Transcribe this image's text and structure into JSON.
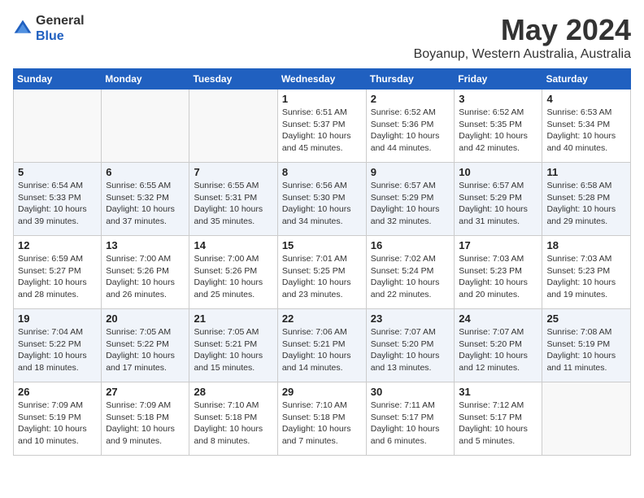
{
  "logo": {
    "general": "General",
    "blue": "Blue"
  },
  "title": {
    "month": "May 2024",
    "location": "Boyanup, Western Australia, Australia"
  },
  "days_of_week": [
    "Sunday",
    "Monday",
    "Tuesday",
    "Wednesday",
    "Thursday",
    "Friday",
    "Saturday"
  ],
  "weeks": [
    [
      {
        "day": null,
        "info": null
      },
      {
        "day": null,
        "info": null
      },
      {
        "day": null,
        "info": null
      },
      {
        "day": "1",
        "info": "Sunrise: 6:51 AM\nSunset: 5:37 PM\nDaylight: 10 hours\nand 45 minutes."
      },
      {
        "day": "2",
        "info": "Sunrise: 6:52 AM\nSunset: 5:36 PM\nDaylight: 10 hours\nand 44 minutes."
      },
      {
        "day": "3",
        "info": "Sunrise: 6:52 AM\nSunset: 5:35 PM\nDaylight: 10 hours\nand 42 minutes."
      },
      {
        "day": "4",
        "info": "Sunrise: 6:53 AM\nSunset: 5:34 PM\nDaylight: 10 hours\nand 40 minutes."
      }
    ],
    [
      {
        "day": "5",
        "info": "Sunrise: 6:54 AM\nSunset: 5:33 PM\nDaylight: 10 hours\nand 39 minutes."
      },
      {
        "day": "6",
        "info": "Sunrise: 6:55 AM\nSunset: 5:32 PM\nDaylight: 10 hours\nand 37 minutes."
      },
      {
        "day": "7",
        "info": "Sunrise: 6:55 AM\nSunset: 5:31 PM\nDaylight: 10 hours\nand 35 minutes."
      },
      {
        "day": "8",
        "info": "Sunrise: 6:56 AM\nSunset: 5:30 PM\nDaylight: 10 hours\nand 34 minutes."
      },
      {
        "day": "9",
        "info": "Sunrise: 6:57 AM\nSunset: 5:29 PM\nDaylight: 10 hours\nand 32 minutes."
      },
      {
        "day": "10",
        "info": "Sunrise: 6:57 AM\nSunset: 5:29 PM\nDaylight: 10 hours\nand 31 minutes."
      },
      {
        "day": "11",
        "info": "Sunrise: 6:58 AM\nSunset: 5:28 PM\nDaylight: 10 hours\nand 29 minutes."
      }
    ],
    [
      {
        "day": "12",
        "info": "Sunrise: 6:59 AM\nSunset: 5:27 PM\nDaylight: 10 hours\nand 28 minutes."
      },
      {
        "day": "13",
        "info": "Sunrise: 7:00 AM\nSunset: 5:26 PM\nDaylight: 10 hours\nand 26 minutes."
      },
      {
        "day": "14",
        "info": "Sunrise: 7:00 AM\nSunset: 5:26 PM\nDaylight: 10 hours\nand 25 minutes."
      },
      {
        "day": "15",
        "info": "Sunrise: 7:01 AM\nSunset: 5:25 PM\nDaylight: 10 hours\nand 23 minutes."
      },
      {
        "day": "16",
        "info": "Sunrise: 7:02 AM\nSunset: 5:24 PM\nDaylight: 10 hours\nand 22 minutes."
      },
      {
        "day": "17",
        "info": "Sunrise: 7:03 AM\nSunset: 5:23 PM\nDaylight: 10 hours\nand 20 minutes."
      },
      {
        "day": "18",
        "info": "Sunrise: 7:03 AM\nSunset: 5:23 PM\nDaylight: 10 hours\nand 19 minutes."
      }
    ],
    [
      {
        "day": "19",
        "info": "Sunrise: 7:04 AM\nSunset: 5:22 PM\nDaylight: 10 hours\nand 18 minutes."
      },
      {
        "day": "20",
        "info": "Sunrise: 7:05 AM\nSunset: 5:22 PM\nDaylight: 10 hours\nand 17 minutes."
      },
      {
        "day": "21",
        "info": "Sunrise: 7:05 AM\nSunset: 5:21 PM\nDaylight: 10 hours\nand 15 minutes."
      },
      {
        "day": "22",
        "info": "Sunrise: 7:06 AM\nSunset: 5:21 PM\nDaylight: 10 hours\nand 14 minutes."
      },
      {
        "day": "23",
        "info": "Sunrise: 7:07 AM\nSunset: 5:20 PM\nDaylight: 10 hours\nand 13 minutes."
      },
      {
        "day": "24",
        "info": "Sunrise: 7:07 AM\nSunset: 5:20 PM\nDaylight: 10 hours\nand 12 minutes."
      },
      {
        "day": "25",
        "info": "Sunrise: 7:08 AM\nSunset: 5:19 PM\nDaylight: 10 hours\nand 11 minutes."
      }
    ],
    [
      {
        "day": "26",
        "info": "Sunrise: 7:09 AM\nSunset: 5:19 PM\nDaylight: 10 hours\nand 10 minutes."
      },
      {
        "day": "27",
        "info": "Sunrise: 7:09 AM\nSunset: 5:18 PM\nDaylight: 10 hours\nand 9 minutes."
      },
      {
        "day": "28",
        "info": "Sunrise: 7:10 AM\nSunset: 5:18 PM\nDaylight: 10 hours\nand 8 minutes."
      },
      {
        "day": "29",
        "info": "Sunrise: 7:10 AM\nSunset: 5:18 PM\nDaylight: 10 hours\nand 7 minutes."
      },
      {
        "day": "30",
        "info": "Sunrise: 7:11 AM\nSunset: 5:17 PM\nDaylight: 10 hours\nand 6 minutes."
      },
      {
        "day": "31",
        "info": "Sunrise: 7:12 AM\nSunset: 5:17 PM\nDaylight: 10 hours\nand 5 minutes."
      },
      {
        "day": null,
        "info": null
      }
    ]
  ]
}
